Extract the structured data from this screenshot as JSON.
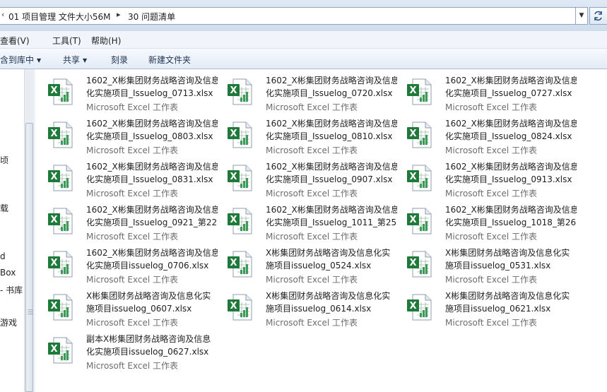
{
  "address": {
    "back_glyph": "‹",
    "crumbs": [
      "01 项目管理 文件大小56M",
      "30 问题清单"
    ],
    "separator": "▸",
    "dropdown_glyph": "▼"
  },
  "menu": {
    "items": [
      "查看(V)",
      "工具(T)",
      "帮助(H)"
    ]
  },
  "commands": {
    "items": [
      {
        "label": "含到库中",
        "arrow": "▼"
      },
      {
        "label": "共享",
        "arrow": "▼"
      },
      {
        "label": "刻录",
        "arrow": ""
      },
      {
        "label": "新建文件夹",
        "arrow": ""
      }
    ]
  },
  "nav": {
    "labels": [
      "顷",
      "载",
      "d",
      "Box",
      "- 书库",
      "游戏"
    ]
  },
  "colors": {
    "excel_green": "#1f7a3a",
    "accent": "#cfdcec"
  },
  "files": [
    {
      "line1": "1602_X彬集团财务战略咨询及信息",
      "line2": "化实施项目_Issuelog_0713.xlsx",
      "type": "Microsoft Excel 工作表"
    },
    {
      "line1": "1602_X彬集团财务战略咨询及信息",
      "line2": "化实施项目_Issuelog_0720.xlsx",
      "type": "Microsoft Excel 工作表"
    },
    {
      "line1": "1602_X彬集团财务战略咨询及信息",
      "line2": "化实施项目_Issuelog_0727.xlsx",
      "type": "Microsoft Excel 工作表"
    },
    {
      "line1": "1602_X彬集团财务战略咨询及信息",
      "line2": "化实施项目_Issuelog_0803.xlsx",
      "type": "Microsoft Excel 工作表"
    },
    {
      "line1": "1602_X彬集团财务战略咨询及信息",
      "line2": "化实施项目_Issuelog_0810.xlsx",
      "type": "Microsoft Excel 工作表"
    },
    {
      "line1": "1602_X彬集团财务战略咨询及信息",
      "line2": "化实施项目_Issuelog_0824.xlsx",
      "type": "Microsoft Excel 工作表"
    },
    {
      "line1": "1602_X彬集团财务战略咨询及信息",
      "line2": "化实施项目_Issuelog_0831.xlsx",
      "type": "Microsoft Excel 工作表"
    },
    {
      "line1": "1602_X彬集团财务战略咨询及信息",
      "line2": "化实施项目_Issuelog_0907.xlsx",
      "type": "Microsoft Excel 工作表"
    },
    {
      "line1": "1602_X彬集团财务战略咨询及信息",
      "line2": "化实施项目_Issuelog_0913.xlsx",
      "type": "Microsoft Excel 工作表"
    },
    {
      "line1": "1602_X彬集团财务战略咨询及信息",
      "line2": "化实施项目_Issuelog_0921_第22...",
      "type": "Microsoft Excel 工作表"
    },
    {
      "line1": "1602_X彬集团财务战略咨询及信息",
      "line2": "化实施项目_Issuelog_1011_第25...",
      "type": "Microsoft Excel 工作表"
    },
    {
      "line1": "1602_X彬集团财务战略咨询及信息",
      "line2": "化实施项目_Issuelog_1018_第26...",
      "type": "Microsoft Excel 工作表"
    },
    {
      "line1": "1602_X彬集团财务战略咨询及信息",
      "line2": "化实施项目issuelog_0706.xlsx",
      "type": "Microsoft Excel 工作表"
    },
    {
      "line1": "X彬集团财务战略咨询及信息化实",
      "line2": "施项目issuelog_0524.xlsx",
      "type": "Microsoft Excel 工作表"
    },
    {
      "line1": "X彬集团财务战略咨询及信息化实",
      "line2": "施项目issuelog_0531.xlsx",
      "type": "Microsoft Excel 工作表"
    },
    {
      "line1": "X彬集团财务战略咨询及信息化实",
      "line2": "施项目issuelog_0607.xlsx",
      "type": "Microsoft Excel 工作表"
    },
    {
      "line1": "X彬集团财务战略咨询及信息化实",
      "line2": "施项目issuelog_0614.xlsx",
      "type": "Microsoft Excel 工作表"
    },
    {
      "line1": "X彬集团财务战略咨询及信息化实",
      "line2": "施项目issuelog_0621.xlsx",
      "type": "Microsoft Excel 工作表"
    },
    {
      "line1": "副本X彬集团财务战略咨询及信息",
      "line2": "化实施项目issuelog_0627.xlsx",
      "type": "Microsoft Excel 工作表"
    }
  ]
}
